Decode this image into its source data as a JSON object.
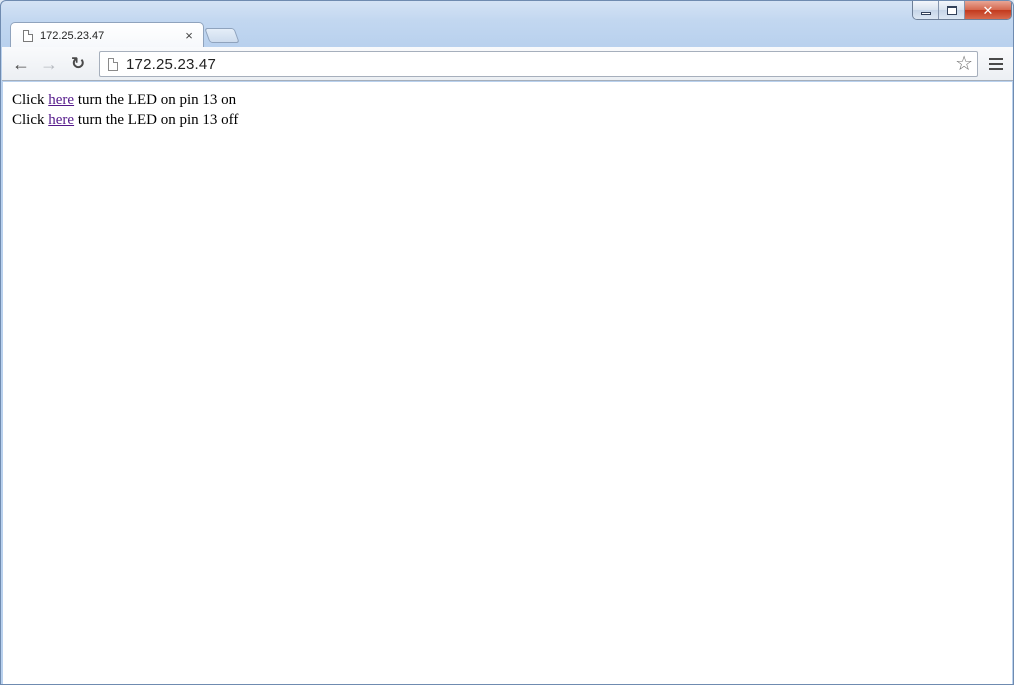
{
  "window": {
    "controls": {
      "minimize": "minimize",
      "maximize": "maximize",
      "close": "✕"
    }
  },
  "tabs": [
    {
      "title": "172.25.23.47",
      "close_glyph": "×",
      "active": true
    }
  ],
  "toolbar": {
    "back_glyph": "←",
    "forward_glyph": "→",
    "reload_glyph": "↻",
    "url": "172.25.23.47",
    "star_glyph": "☆"
  },
  "content": {
    "lines": [
      {
        "prefix": "Click ",
        "link": "here",
        "suffix": " turn the LED on pin 13 on"
      },
      {
        "prefix": "Click ",
        "link": "here",
        "suffix": " turn the LED on pin 13 off"
      }
    ]
  },
  "colors": {
    "visited_link": "#551a8b",
    "window_frame": "#c2d7f0",
    "close_button": "#c2391d"
  }
}
